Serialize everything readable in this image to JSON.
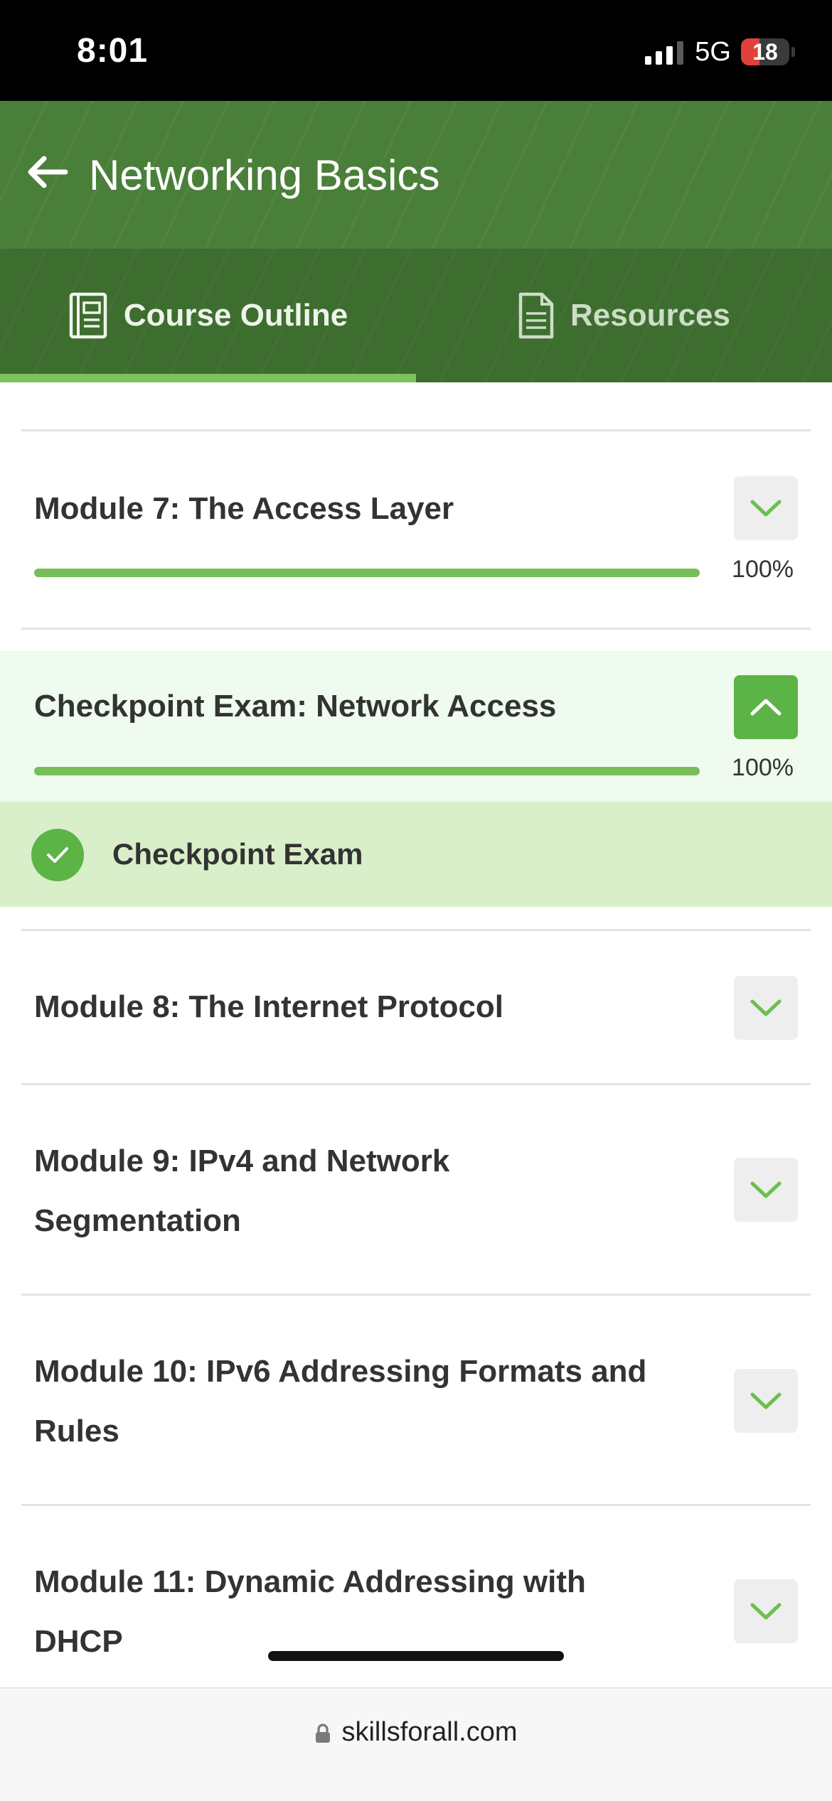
{
  "status_bar": {
    "time": "8:01",
    "network": "5G",
    "battery": "18"
  },
  "header": {
    "title": "Networking Basics"
  },
  "tabs": [
    {
      "label": "Course Outline",
      "active": true
    },
    {
      "label": "Resources",
      "active": false
    }
  ],
  "modules": [
    {
      "title": "Module 7: The Access Layer",
      "progress": "100%",
      "expanded": false
    },
    {
      "title": "Checkpoint Exam: Network Access",
      "progress": "100%",
      "expanded": true,
      "children": [
        {
          "label": "Checkpoint Exam",
          "completed": true
        }
      ]
    },
    {
      "title_lines": [
        "Module 8: The Internet Protocol"
      ],
      "expanded": false
    },
    {
      "title_lines": [
        "Module 9: IPv4 and Network",
        "Segmentation"
      ],
      "expanded": false
    },
    {
      "title_lines": [
        "Module 10: IPv6 Addressing Formats and",
        "Rules"
      ],
      "expanded": false
    },
    {
      "title_lines": [
        "Module 11: Dynamic Addressing with",
        "DHCP"
      ],
      "expanded": false
    }
  ],
  "browser": {
    "url": "skillsforall.com"
  },
  "colors": {
    "brand_green": "#4a7f3a",
    "accent_green": "#5cb346",
    "progress_green": "#78be58"
  }
}
